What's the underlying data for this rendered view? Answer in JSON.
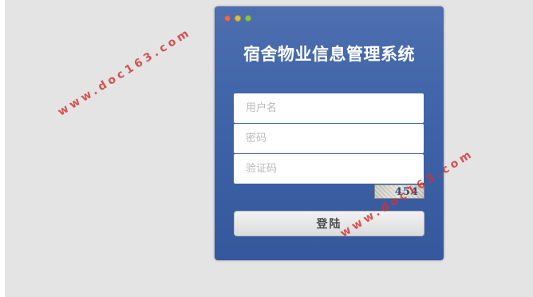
{
  "login": {
    "title": "宿舍物业信息管理系统",
    "username_placeholder": "用户名",
    "password_placeholder": "密码",
    "captcha_placeholder": "验证码",
    "captcha_code": "454",
    "submit_label": "登陆"
  },
  "watermarks": [
    "www.doc163.com",
    "www.doc163.com"
  ],
  "colors": {
    "panel": "#4267a9",
    "page_background": "#e4e4e4",
    "watermark": "#d63030"
  }
}
